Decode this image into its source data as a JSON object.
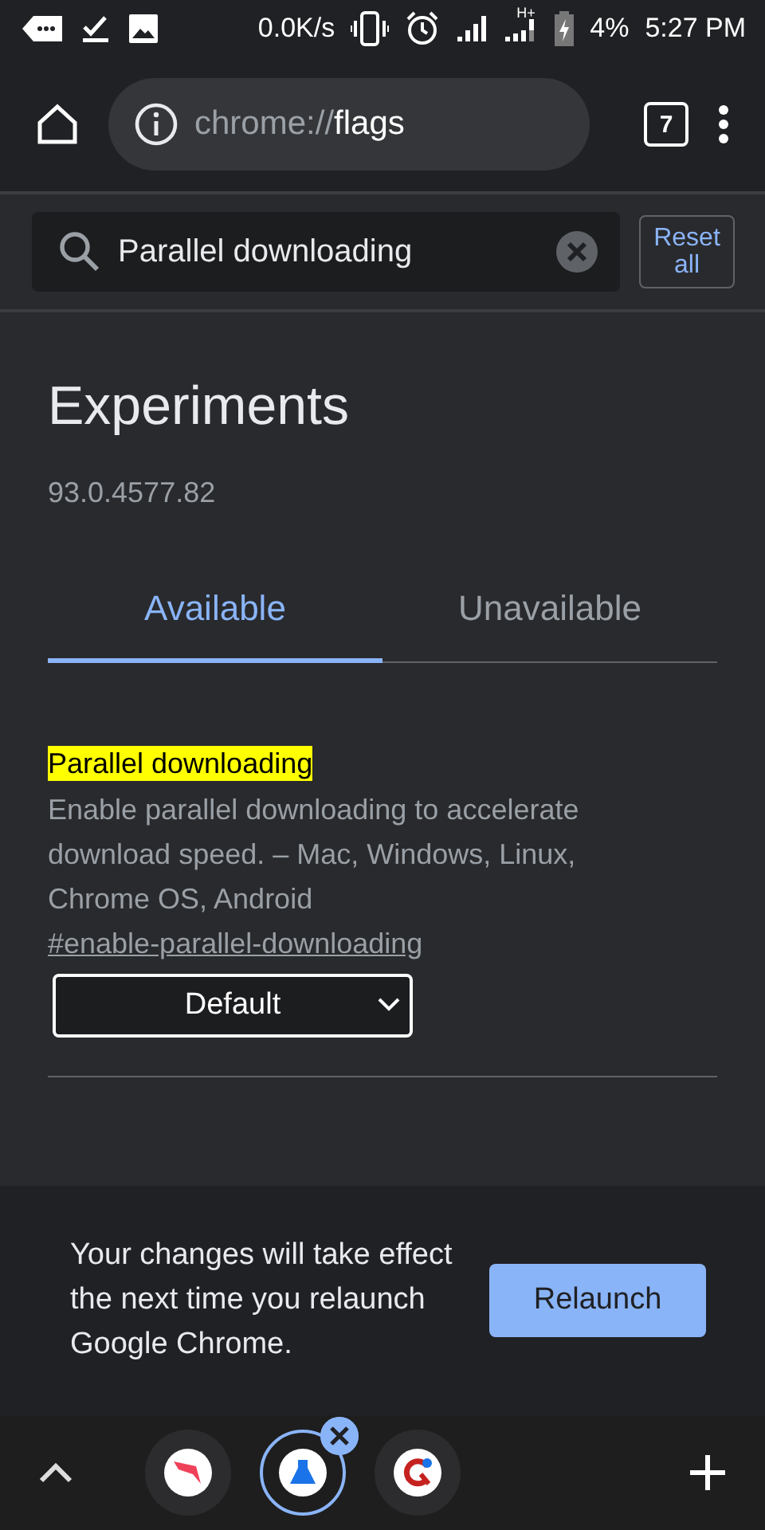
{
  "status_bar": {
    "speed": "0.0K/s",
    "network_type": "H+",
    "battery": "4%",
    "time": "5:27 PM"
  },
  "toolbar": {
    "url_scheme": "chrome://",
    "url_host": "flags",
    "tab_count": "7"
  },
  "search": {
    "value": "Parallel downloading",
    "reset_button": "Reset all"
  },
  "page": {
    "title": "Experiments",
    "version": "93.0.4577.82",
    "tabs": [
      {
        "label": "Available",
        "selected": true
      },
      {
        "label": "Unavailable",
        "selected": false
      }
    ],
    "flags": [
      {
        "name": "Parallel downloading",
        "highlighted": true,
        "description": "Enable parallel downloading to accelerate download speed. – Mac, Windows, Linux, Chrome OS, Android",
        "link": "#enable-parallel-downloading",
        "value": "Default"
      }
    ]
  },
  "banner": {
    "message": "Your changes will take effect the next time you relaunch Google Chrome.",
    "button": "Relaunch"
  },
  "tab_strip": {
    "tabs": [
      {
        "selected": false
      },
      {
        "selected": true
      },
      {
        "selected": false
      }
    ]
  }
}
